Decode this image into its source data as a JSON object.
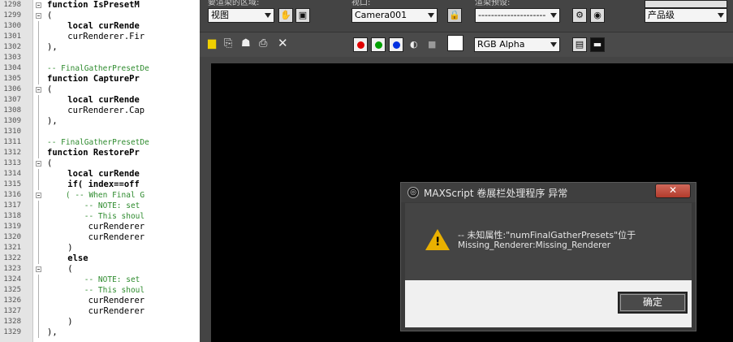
{
  "editor": {
    "lines": [
      {
        "n": "1298",
        "t": "function IsPresetM",
        "k": "kw",
        "fold": true
      },
      {
        "n": "1299",
        "t": "(",
        "k": "",
        "fold": true
      },
      {
        "n": "1300",
        "t": "    local curRende",
        "k": "kw",
        "fold": false
      },
      {
        "n": "1301",
        "t": "    curRenderer.Fir",
        "k": "",
        "fold": false
      },
      {
        "n": "1302",
        "t": "),",
        "k": "",
        "fold": false
      },
      {
        "n": "1303",
        "t": "",
        "k": "",
        "fold": false
      },
      {
        "n": "1304",
        "t": "-- FinalGatherPresetDe",
        "k": "cm",
        "fold": false
      },
      {
        "n": "1305",
        "t": "function CapturePr",
        "k": "kw",
        "fold": false
      },
      {
        "n": "1306",
        "t": "(",
        "k": "",
        "fold": true
      },
      {
        "n": "1307",
        "t": "    local curRende",
        "k": "kw",
        "fold": false
      },
      {
        "n": "1308",
        "t": "    curRenderer.Cap",
        "k": "",
        "fold": false
      },
      {
        "n": "1309",
        "t": "),",
        "k": "",
        "fold": false
      },
      {
        "n": "1310",
        "t": "",
        "k": "",
        "fold": false
      },
      {
        "n": "1311",
        "t": "-- FinalGatherPresetDe",
        "k": "cm",
        "fold": false
      },
      {
        "n": "1312",
        "t": "function RestorePr",
        "k": "kw",
        "fold": false
      },
      {
        "n": "1313",
        "t": "(",
        "k": "",
        "fold": true
      },
      {
        "n": "1314",
        "t": "    local curRende",
        "k": "kw",
        "fold": false
      },
      {
        "n": "1315",
        "t": "    if( index==off",
        "k": "kw",
        "fold": false
      },
      {
        "n": "1316",
        "t": "    ( -- When Final G",
        "k": "cm",
        "fold": true
      },
      {
        "n": "1317",
        "t": "        -- NOTE: set",
        "k": "cm",
        "fold": false
      },
      {
        "n": "1318",
        "t": "        -- This shoul",
        "k": "cm",
        "fold": false
      },
      {
        "n": "1319",
        "t": "        curRenderer",
        "k": "",
        "fold": false
      },
      {
        "n": "1320",
        "t": "        curRenderer",
        "k": "",
        "fold": false
      },
      {
        "n": "1321",
        "t": "    )",
        "k": "",
        "fold": false
      },
      {
        "n": "1322",
        "t": "    else",
        "k": "kw",
        "fold": false
      },
      {
        "n": "1323",
        "t": "    (",
        "k": "",
        "fold": true
      },
      {
        "n": "1324",
        "t": "        -- NOTE: set",
        "k": "cm",
        "fold": false
      },
      {
        "n": "1325",
        "t": "        -- This shoul",
        "k": "cm",
        "fold": false
      },
      {
        "n": "1326",
        "t": "        curRenderer",
        "k": "",
        "fold": false
      },
      {
        "n": "1327",
        "t": "        curRenderer",
        "k": "",
        "fold": false
      },
      {
        "n": "1328",
        "t": "    )",
        "k": "",
        "fold": false
      },
      {
        "n": "1329",
        "t": "),",
        "k": "",
        "fold": false
      }
    ]
  },
  "render": {
    "label_area": "要渲染的区域:",
    "label_viewport": "视口:",
    "label_preset": "渲染预设:",
    "area_value": "视图",
    "viewport_value": "Camera001",
    "preset_value": "---------------------",
    "level_value": "产品级",
    "channel_value": "RGB Alpha",
    "colors": {
      "red": "#e00000",
      "green": "#00a000",
      "blue": "#0030e0"
    }
  },
  "dialog": {
    "title": "MAXScript 卷展栏处理程序 异常",
    "close_glyph": "✕",
    "message_line1": "-- 未知属性:\"numFinalGatherPresets\"位于",
    "message_line2": "Missing_Renderer:Missing_Renderer",
    "ok_label": "确定"
  }
}
